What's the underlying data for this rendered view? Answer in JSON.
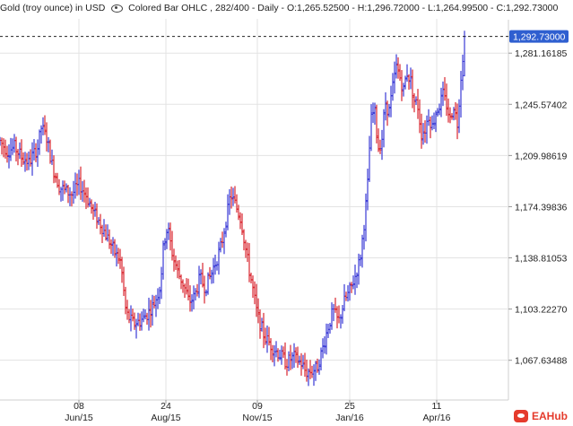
{
  "header": {
    "instrument": "Gold (troy ounce) in USD",
    "study": "Colored Bar OHLC , 282/400 - Daily - O:1,265.52500 - H:1,296.72000 - L:1,264.99500 - C:1,292.73000",
    "eye_icon": "eye-icon"
  },
  "watermark": {
    "text": "EAHub",
    "icon": "eahub-logo-icon"
  },
  "colors": {
    "up": "#3a3ad6",
    "down": "#d9262e",
    "grid": "#e3e3e3",
    "price_tag": "#2f5fd0"
  },
  "chart_data": {
    "type": "ohlc",
    "title": "Gold (troy ounce) in USD",
    "frequency": "Daily",
    "bars_shown": "282/400",
    "last_bar": {
      "open": 1265.525,
      "high": 1296.72,
      "low": 1264.995,
      "close": 1292.73
    },
    "last_price_label": "1,292.73000",
    "y_ticks": [
      {
        "value": 1281.16185,
        "label": "1,281.16185"
      },
      {
        "value": 1245.57402,
        "label": "1,245.57402"
      },
      {
        "value": 1209.98619,
        "label": "1,209.98619"
      },
      {
        "value": 1174.39836,
        "label": "1,174.39836"
      },
      {
        "value": 1138.81053,
        "label": "1,138.81053"
      },
      {
        "value": 1103.2227,
        "label": "1,103.22270"
      },
      {
        "value": 1067.63488,
        "label": "1,067.63488"
      }
    ],
    "x_ticks": [
      {
        "day": "08",
        "month": "Jun/15"
      },
      {
        "day": "24",
        "month": "Aug/15"
      },
      {
        "day": "09",
        "month": "Nov/15"
      },
      {
        "day": "25",
        "month": "Jan/16"
      },
      {
        "day": "11",
        "month": "Apr/16"
      }
    ],
    "ylim": [
      1040,
      1305
    ],
    "grid": true,
    "close_anchors": [
      [
        0,
        1220
      ],
      [
        8,
        1213
      ],
      [
        16,
        1216
      ],
      [
        24,
        1209
      ],
      [
        32,
        1205
      ],
      [
        42,
        1216
      ],
      [
        46,
        1230
      ],
      [
        52,
        1222
      ],
      [
        58,
        1203
      ],
      [
        66,
        1188
      ],
      [
        74,
        1185
      ],
      [
        80,
        1183
      ],
      [
        88,
        1190
      ],
      [
        96,
        1182
      ],
      [
        104,
        1170
      ],
      [
        112,
        1162
      ],
      [
        120,
        1152
      ],
      [
        128,
        1142
      ],
      [
        134,
        1136
      ],
      [
        140,
        1100
      ],
      [
        148,
        1093
      ],
      [
        156,
        1095
      ],
      [
        164,
        1100
      ],
      [
        172,
        1108
      ],
      [
        178,
        1120
      ],
      [
        182,
        1150
      ],
      [
        186,
        1160
      ],
      [
        192,
        1140
      ],
      [
        198,
        1128
      ],
      [
        204,
        1120
      ],
      [
        210,
        1108
      ],
      [
        216,
        1112
      ],
      [
        222,
        1125
      ],
      [
        228,
        1118
      ],
      [
        236,
        1130
      ],
      [
        242,
        1140
      ],
      [
        246,
        1148
      ],
      [
        252,
        1168
      ],
      [
        256,
        1183
      ],
      [
        262,
        1175
      ],
      [
        268,
        1165
      ],
      [
        274,
        1140
      ],
      [
        280,
        1120
      ],
      [
        286,
        1098
      ],
      [
        294,
        1084
      ],
      [
        302,
        1077
      ],
      [
        310,
        1072
      ],
      [
        318,
        1066
      ],
      [
        326,
        1070
      ],
      [
        334,
        1066
      ],
      [
        340,
        1059
      ],
      [
        346,
        1060
      ],
      [
        352,
        1062
      ],
      [
        358,
        1075
      ],
      [
        364,
        1090
      ],
      [
        370,
        1102
      ],
      [
        376,
        1094
      ],
      [
        382,
        1108
      ],
      [
        388,
        1115
      ],
      [
        394,
        1125
      ],
      [
        400,
        1138
      ],
      [
        404,
        1160
      ],
      [
        408,
        1185
      ],
      [
        412,
        1235
      ],
      [
        416,
        1242
      ],
      [
        420,
        1215
      ],
      [
        424,
        1220
      ],
      [
        428,
        1247
      ],
      [
        432,
        1240
      ],
      [
        436,
        1256
      ],
      [
        440,
        1272
      ],
      [
        444,
        1265
      ],
      [
        448,
        1255
      ],
      [
        452,
        1268
      ],
      [
        456,
        1262
      ],
      [
        460,
        1248
      ],
      [
        464,
        1245
      ],
      [
        468,
        1225
      ],
      [
        472,
        1228
      ],
      [
        476,
        1238
      ],
      [
        480,
        1230
      ],
      [
        484,
        1240
      ],
      [
        488,
        1245
      ],
      [
        492,
        1252
      ],
      [
        496,
        1245
      ],
      [
        500,
        1235
      ],
      [
        504,
        1245
      ],
      [
        508,
        1232
      ],
      [
        512,
        1265
      ],
      [
        516,
        1292.73
      ]
    ]
  }
}
